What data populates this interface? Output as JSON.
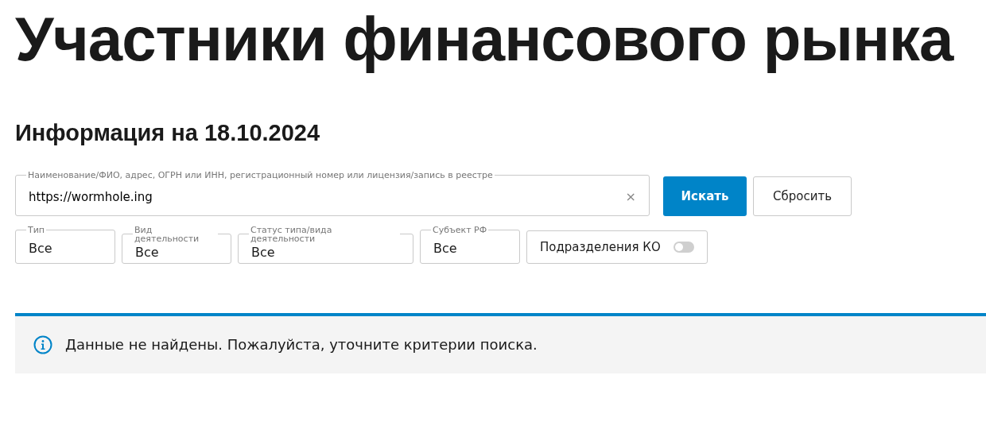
{
  "page_title": "Участники финансового рынка",
  "subtitle": "Информация на 18.10.2024",
  "search": {
    "label": "Наименование/ФИО, адрес, ОГРН или ИНН, регистрационный номер или лицензия/запись в реестре",
    "value": "https://wormhole.ing",
    "clear": "×"
  },
  "buttons": [
    {
      "label": "Искать",
      "kind": "primary"
    },
    {
      "label": "Сбросить",
      "kind": "secondary"
    }
  ],
  "filters": [
    {
      "label": "Тип",
      "value": "Все"
    },
    {
      "label": "Вид деятельности",
      "value": "Все"
    },
    {
      "label": "Статус типа/вида деятельности",
      "value": "Все"
    },
    {
      "label": "Субъект РФ",
      "value": "Все"
    }
  ],
  "toggle": {
    "label": "Подразделения КО",
    "on": false
  },
  "notice": {
    "text": "Данные не найдены. Пожалуйста, уточните критерии поиска."
  }
}
